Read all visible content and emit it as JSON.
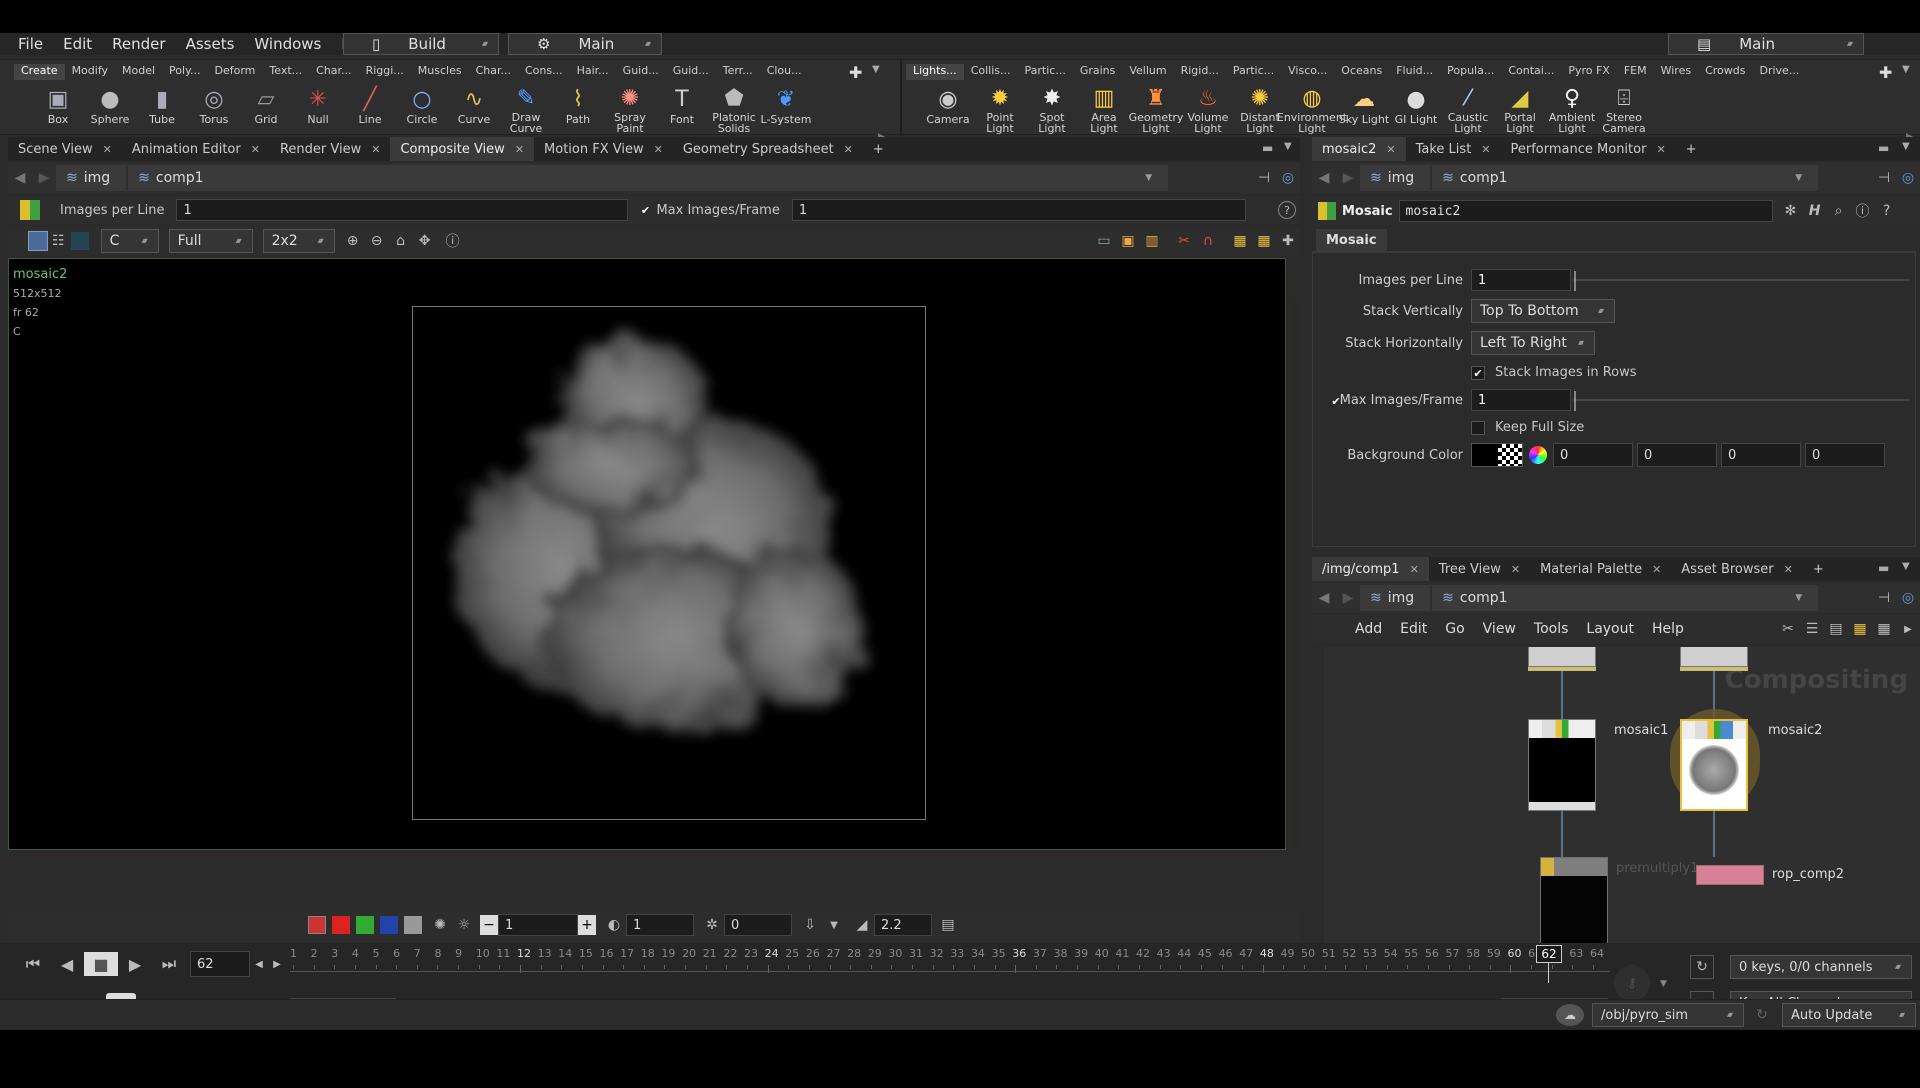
{
  "menubar": {
    "items": [
      "File",
      "Edit",
      "Render",
      "Assets",
      "Windows",
      "Help"
    ],
    "desktop": "Build",
    "context": "Main",
    "right_desktop": "Main"
  },
  "shelf_left": {
    "tabs": [
      "Create",
      "Modify",
      "Model",
      "Poly...",
      "Deform",
      "Text...",
      "Char...",
      "Riggi...",
      "Muscles",
      "Char...",
      "Cons...",
      "Hair...",
      "Guid...",
      "Guid...",
      "Terr...",
      "Clou..."
    ],
    "tools": [
      {
        "label": "Box",
        "icon": "▣",
        "c": "#aab"
      },
      {
        "label": "Sphere",
        "icon": "●",
        "c": "#bbb"
      },
      {
        "label": "Tube",
        "icon": "▮",
        "c": "#aab"
      },
      {
        "label": "Torus",
        "icon": "◎",
        "c": "#aab"
      },
      {
        "label": "Grid",
        "icon": "▱",
        "c": "#999"
      },
      {
        "label": "Null",
        "icon": "✳",
        "c": "#e05050"
      },
      {
        "label": "Line",
        "icon": "╱",
        "c": "#e06060"
      },
      {
        "label": "Circle",
        "icon": "○",
        "c": "#88aaff"
      },
      {
        "label": "Curve",
        "icon": "∿",
        "c": "#e0c050"
      },
      {
        "label": "Draw Curve",
        "icon": "✎",
        "c": "#5aa0ff"
      },
      {
        "label": "Path",
        "icon": "⌇",
        "c": "#e0c050"
      },
      {
        "label": "Spray Paint",
        "icon": "✺",
        "c": "#ff9080"
      },
      {
        "label": "Font",
        "icon": "T",
        "c": "#ccc"
      },
      {
        "label": "Platonic Solids",
        "icon": "⬟",
        "c": "#bbb"
      },
      {
        "label": "L-System",
        "icon": "❦",
        "c": "#4a9aff"
      }
    ]
  },
  "shelf_right": {
    "tabs": [
      "Lights...",
      "Collis...",
      "Partic...",
      "Grains",
      "Vellum",
      "Rigid...",
      "Partic...",
      "Visco...",
      "Oceans",
      "Fluid...",
      "Popula...",
      "Contai...",
      "Pyro FX",
      "FEM",
      "Wires",
      "Crowds",
      "Drive..."
    ],
    "tools": [
      {
        "label": "Camera",
        "icon": "◉",
        "c": "#ccc"
      },
      {
        "label": "Point Light",
        "icon": "✹",
        "c": "#ffcc40"
      },
      {
        "label": "Spot Light",
        "icon": "✸",
        "c": "#eee"
      },
      {
        "label": "Area Light",
        "icon": "▥",
        "c": "#ffcc40"
      },
      {
        "label": "Geometry Light",
        "icon": "♜",
        "c": "#ff9040"
      },
      {
        "label": "Volume Light",
        "icon": "♨",
        "c": "#ff7030"
      },
      {
        "label": "Distant Light",
        "icon": "✺",
        "c": "#ffcc40"
      },
      {
        "label": "Environment Light",
        "icon": "◍",
        "c": "#ffd040"
      },
      {
        "label": "Sky Light",
        "icon": "☁",
        "c": "#ffcc80"
      },
      {
        "label": "GI Light",
        "icon": "●",
        "c": "#ddd"
      },
      {
        "label": "Caustic Light",
        "icon": "⁄",
        "c": "#aaccff"
      },
      {
        "label": "Portal Light",
        "icon": "◢",
        "c": "#ddcc40"
      },
      {
        "label": "Ambient Light",
        "icon": "♀",
        "c": "#eee"
      },
      {
        "label": "Stereo Camera",
        "icon": "⌹",
        "c": "#ccc"
      }
    ]
  },
  "left_pane": {
    "tabs": [
      "Scene View",
      "Animation Editor",
      "Render View",
      "Composite View",
      "Motion FX View",
      "Geometry Spreadsheet"
    ],
    "active": 3,
    "path": [
      "img",
      "comp1"
    ],
    "options": {
      "images_per_line_label": "Images per Line",
      "images_per_line": "1",
      "max_images_label": "Max Images/Frame",
      "max_images": "1"
    },
    "viewer_controls": {
      "channel": "C",
      "res": "Full",
      "grid": "2x2"
    },
    "overlay": {
      "name": "mosaic2",
      "res": "512x512",
      "frame": "fr 62",
      "plane": "C"
    },
    "bottom": {
      "v1": "1",
      "v2": "1",
      "v3": "0",
      "gamma": "2.2"
    }
  },
  "params": {
    "tabs": [
      "mosaic2",
      "Take List",
      "Performance Monitor"
    ],
    "path": [
      "img",
      "comp1"
    ],
    "node_type": "Mosaic",
    "node_name": "mosaic2",
    "section": "Mosaic",
    "rows": {
      "images_per_line_label": "Images per Line",
      "images_per_line": "1",
      "stack_vert_label": "Stack Vertically",
      "stack_vert": "Top To Bottom",
      "stack_horiz_label": "Stack Horizontally",
      "stack_horiz": "Left To Right",
      "stack_rows_label": "Stack Images in Rows",
      "max_label": "Max Images/Frame",
      "max": "1",
      "keep_label": "Keep Full Size",
      "bg_label": "Background Color",
      "bg": [
        "0",
        "0",
        "0",
        "0"
      ]
    }
  },
  "network": {
    "tabs": [
      "/img/comp1",
      "Tree View",
      "Material Palette",
      "Asset Browser"
    ],
    "path": [
      "img",
      "comp1"
    ],
    "menu": [
      "Add",
      "Edit",
      "Go",
      "View",
      "Tools",
      "Layout",
      "Help"
    ],
    "watermark": "Compositing",
    "nodes": {
      "mosaic1": "mosaic1",
      "mosaic2": "mosaic2",
      "premult": "premultiply1",
      "rop": "rop_comp2"
    }
  },
  "timeline": {
    "frame": "62",
    "ticks": [
      "1",
      "2",
      "3",
      "4",
      "5",
      "6",
      "7",
      "8",
      "9",
      "10",
      "11",
      "12",
      "13",
      "14",
      "15",
      "16",
      "17",
      "18",
      "19",
      "20",
      "21",
      "22",
      "23",
      "24",
      "25",
      "26",
      "27",
      "28",
      "29",
      "30",
      "31",
      "32",
      "33",
      "34",
      "35",
      "36",
      "37",
      "38",
      "39",
      "40",
      "41",
      "42",
      "43",
      "44",
      "45",
      "46",
      "47",
      "48",
      "49",
      "50",
      "51",
      "52",
      "53",
      "54",
      "55",
      "56",
      "57",
      "58",
      "59",
      "60",
      "61",
      "62",
      "63",
      "64"
    ],
    "range_start": "1",
    "range_start2": "1",
    "range_end": "64",
    "range_end2": "64",
    "keys": "0 keys, 0/0 channels",
    "key_all": "Key All Channels"
  },
  "status": {
    "path": "/obj/pyro_sim",
    "update": "Auto Update"
  }
}
